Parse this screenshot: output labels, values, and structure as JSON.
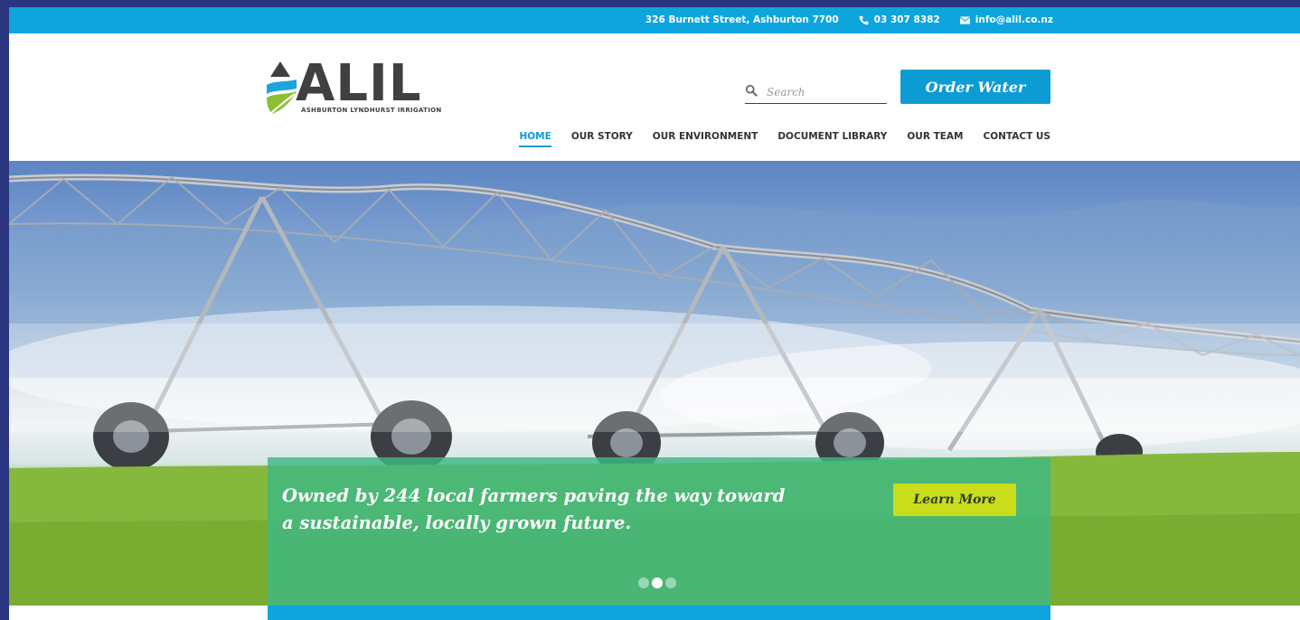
{
  "topbar": {
    "address": "326 Burnett Street, Ashburton 7700",
    "phone": "03 307 8382",
    "email": "info@alil.co.nz"
  },
  "logo": {
    "wordmark": "ALIL",
    "tagline": "ASHBURTON LYNDHURST IRRIGATION"
  },
  "search": {
    "placeholder": "Search"
  },
  "order_button": {
    "label": "Order Water"
  },
  "nav": {
    "items": [
      {
        "label": "HOME",
        "active": true
      },
      {
        "label": "OUR STORY"
      },
      {
        "label": "OUR ENVIRONMENT"
      },
      {
        "label": "DOCUMENT LIBRARY"
      },
      {
        "label": "OUR TEAM"
      },
      {
        "label": "CONTACT US"
      }
    ]
  },
  "hero": {
    "caption": "Owned by 244 local farmers paving the way toward a sustainable, locally grown future.",
    "button_label": "Learn More",
    "slides": 3,
    "active_slide": 2
  },
  "colors": {
    "brand_blue": "#0ea5df",
    "button_blue": "#0d9bd4",
    "caption_green": "#40b882",
    "learn_more_lime": "#c9dd1c",
    "frame_navy": "#2a3580"
  },
  "icons": [
    "phone-icon",
    "mail-icon",
    "search-icon",
    "logo-drop-icon"
  ]
}
